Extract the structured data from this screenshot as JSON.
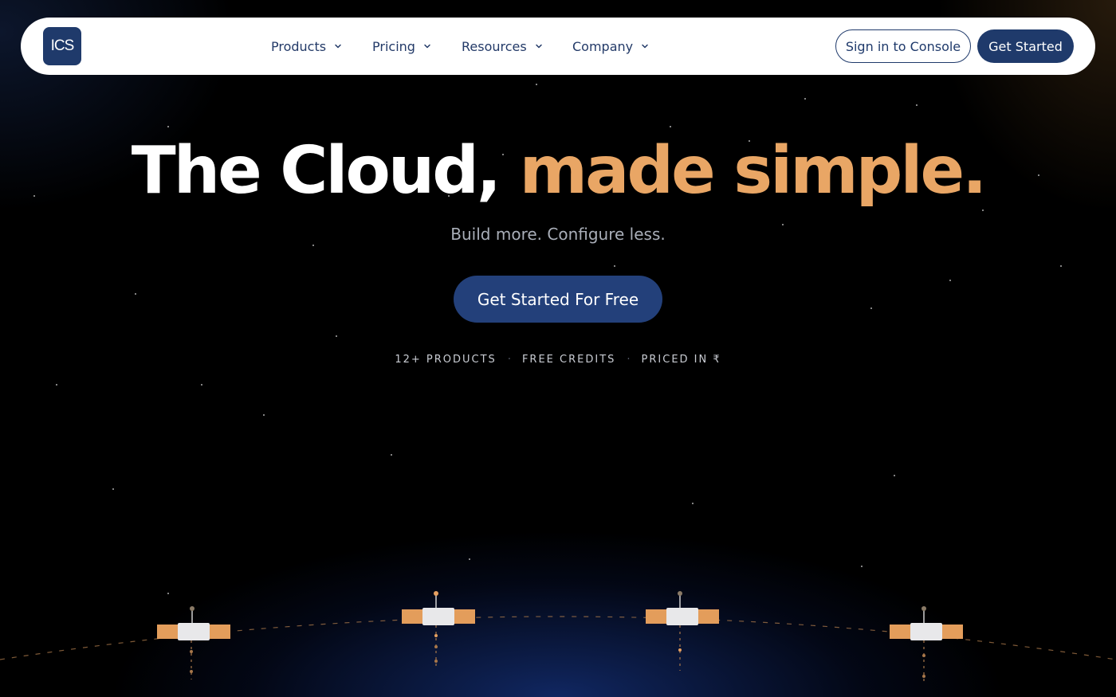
{
  "navbar": {
    "logo_text": "ICS",
    "items": [
      {
        "label": "Products",
        "icon": "chevron-down-icon"
      },
      {
        "label": "Pricing",
        "icon": "chevron-down-icon"
      },
      {
        "label": "Resources",
        "icon": "chevron-down-icon"
      },
      {
        "label": "Company",
        "icon": "chevron-down-icon"
      }
    ],
    "signin_label": "Sign in to Console",
    "get_started_label": "Get Started"
  },
  "hero": {
    "title_part1": "The Cloud,",
    "title_part2": "made simple.",
    "subtitle": "Build more. Configure less.",
    "cta_label": "Get Started For Free",
    "features": [
      "12+ PRODUCTS",
      "FREE CREDITS",
      "PRICED IN ₹"
    ],
    "feature_separator": "·"
  },
  "decor": {
    "satellite_count": 4,
    "satellite_icon": "satellite-icon"
  },
  "colors": {
    "accent": "#e9a665",
    "brand": "#1f3a6b",
    "cta": "#23407a",
    "background": "#000000"
  }
}
